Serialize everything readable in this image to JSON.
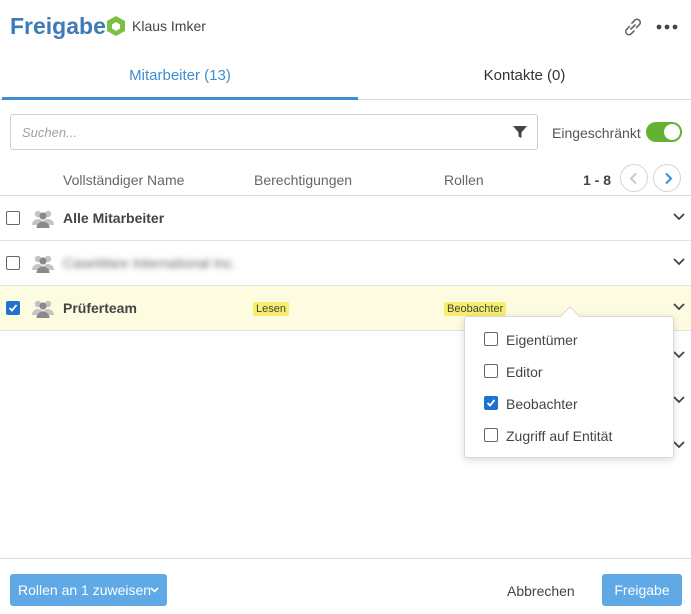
{
  "header": {
    "title": "Freigabe",
    "owner_name": "Klaus Imker"
  },
  "tabs": [
    {
      "label": "Mitarbeiter (13)",
      "active": true
    },
    {
      "label": "Kontakte (0)",
      "active": false
    }
  ],
  "search": {
    "placeholder": "Suchen...",
    "value": ""
  },
  "restricted": {
    "label": "Eingeschränkt",
    "enabled": true
  },
  "columns": {
    "name": "Vollständiger Name",
    "permissions": "Berechtigungen",
    "roles": "Rollen"
  },
  "pager": {
    "range": "1 - 8"
  },
  "rows": [
    {
      "name": "Alle Mitarbeiter",
      "checked": false,
      "permission": "",
      "role": ""
    },
    {
      "name": "CaseWare International Inc.",
      "checked": false,
      "permission": "",
      "role": "",
      "blurred": true
    },
    {
      "name": "Prüferteam",
      "checked": true,
      "permission": "Lesen",
      "role": "Beobachter"
    }
  ],
  "role_dropdown": {
    "options": [
      {
        "label": "Eigentümer",
        "checked": false
      },
      {
        "label": "Editor",
        "checked": false
      },
      {
        "label": "Beobachter",
        "checked": true
      },
      {
        "label": "Zugriff auf Entität",
        "checked": false
      }
    ]
  },
  "footer": {
    "assign_label": "Rollen an 1 zuweisen",
    "cancel_label": "Abbrechen",
    "confirm_label": "Freigabe"
  },
  "colors": {
    "title": "#3d7ab8",
    "accent": "#3d8fd1",
    "button": "#5fa9e6",
    "toggle": "#63b231",
    "highlight": "#f6ee6c",
    "selected_row": "#fdfbe0",
    "owner_hex": "#7ac143"
  }
}
